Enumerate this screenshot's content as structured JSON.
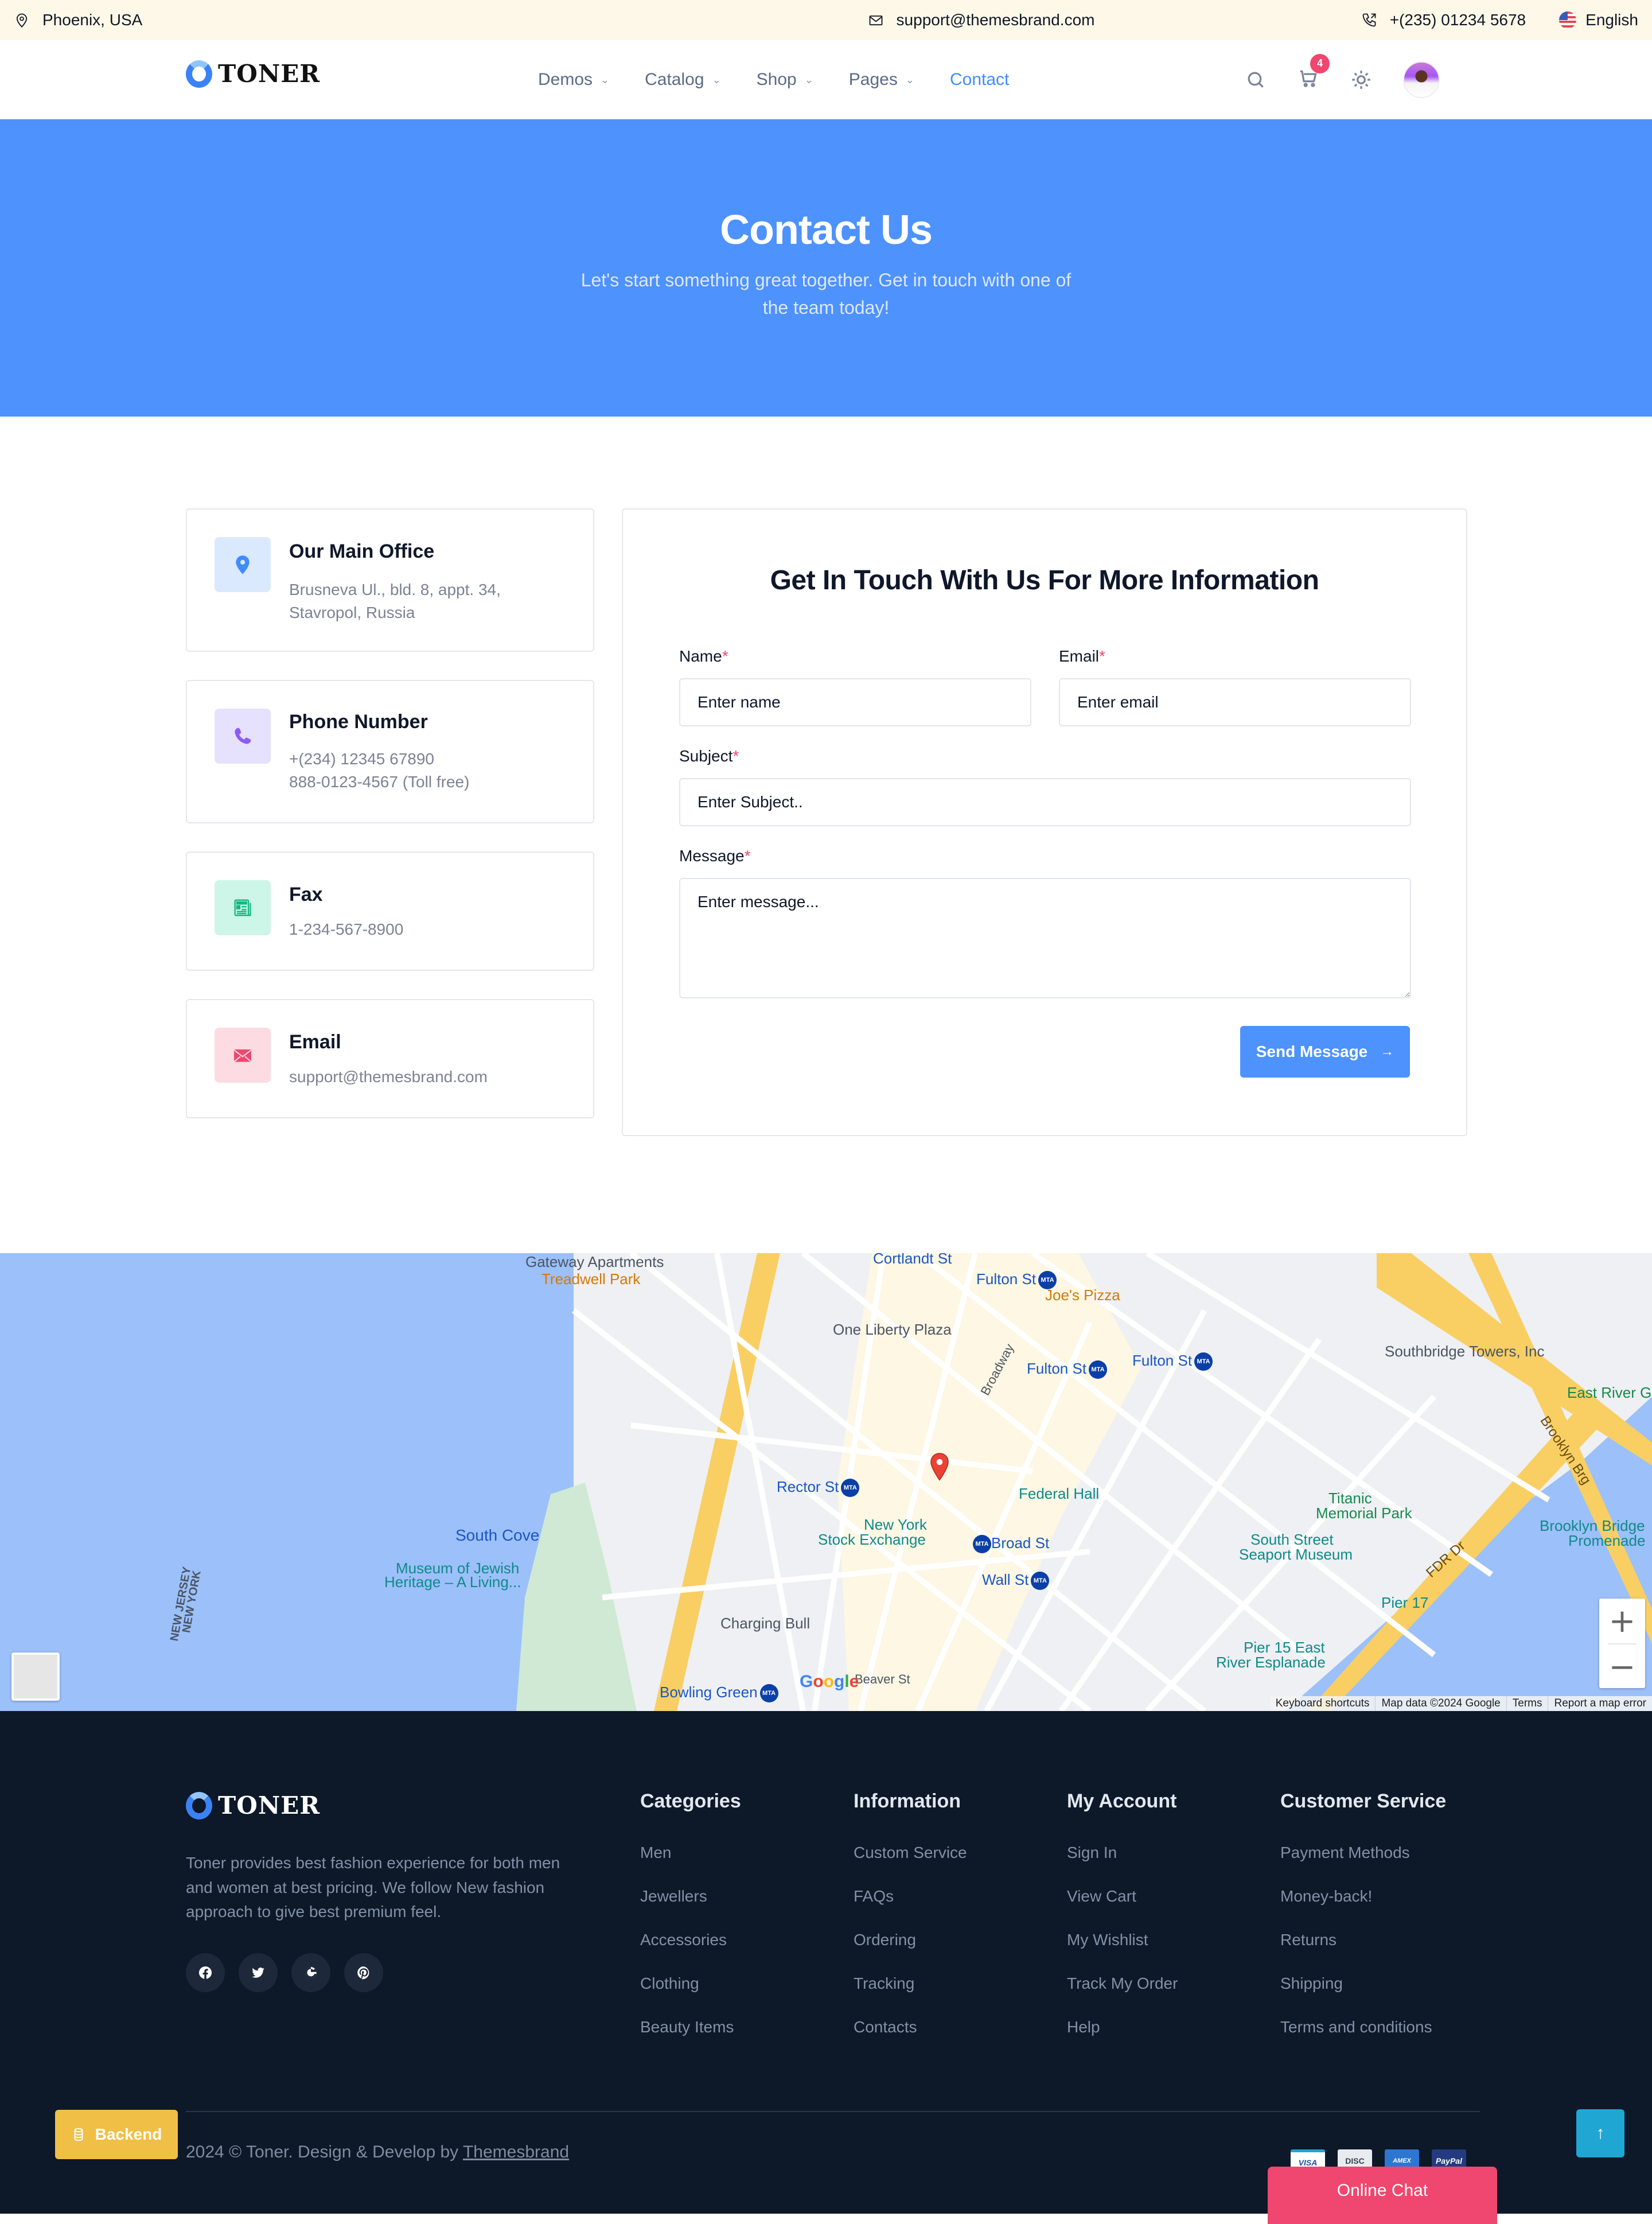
{
  "topbar": {
    "location": "Phoenix, USA",
    "email": "support@themesbrand.com",
    "phone": "+(235) 01234 5678",
    "language": "English"
  },
  "nav": {
    "brand": "TONER",
    "menu": [
      {
        "label": "Demos",
        "dropdown": true
      },
      {
        "label": "Catalog",
        "dropdown": true
      },
      {
        "label": "Shop",
        "dropdown": true
      },
      {
        "label": "Pages",
        "dropdown": true
      },
      {
        "label": "Contact",
        "dropdown": false,
        "active": true
      }
    ],
    "cart_count": "4",
    "icons": [
      "search-icon",
      "cart-icon",
      "theme-toggle-icon",
      "avatar"
    ]
  },
  "hero": {
    "title": "Contact Us",
    "subtitle": "Let's start something great together. Get in touch with one of the team today!"
  },
  "info_cards": [
    {
      "icon": "map-pin-icon",
      "title": "Our Main Office",
      "lines": [
        "Brusneva Ul., bld. 8, appt. 34,",
        "Stavropol, Russia"
      ],
      "color": "#3f8cff",
      "bg": "#dbe9ff"
    },
    {
      "icon": "phone-icon",
      "title": "Phone Number",
      "lines": [
        "+(234) 12345 67890",
        "888-0123-4567 (Toll free)"
      ],
      "color": "#8b5cf6",
      "bg": "#e6e1fd"
    },
    {
      "icon": "fax-icon",
      "title": "Fax",
      "lines": [
        "1-234-567-8900"
      ],
      "color": "#10b981",
      "bg": "#cdf6e8"
    },
    {
      "icon": "mail-icon",
      "title": "Email",
      "lines": [
        "support@themesbrand.com"
      ],
      "color": "#ef476f",
      "bg": "#fddbe3"
    }
  ],
  "form": {
    "title": "Get In Touch With Us For More Information",
    "name_label": "Name",
    "name_placeholder": "Enter name",
    "email_label": "Email",
    "email_placeholder": "Enter email",
    "subject_label": "Subject",
    "subject_placeholder": "Enter Subject..",
    "message_label": "Message",
    "message_placeholder": "Enter message...",
    "required_mark": "*",
    "submit_label": "Send Message",
    "submit_icon": "arrow-right-icon"
  },
  "map": {
    "labels": {
      "gateway": "Gateway Apartments",
      "treadwell": "Treadwell Park",
      "cortlandt": "Cortlandt St",
      "fulton1": "Fulton St",
      "joes": "Joe's Pizza",
      "liberty_plaza": "One Liberty Plaza",
      "fulton2": "Fulton St",
      "fulton3": "Fulton St",
      "southbridge": "Southbridge Towers, Inc",
      "east_river": "East River G",
      "rector": "Rector St",
      "federal_hall": "Federal Hall",
      "nyse1": "New York",
      "nyse2": "Stock Exchange",
      "broad": "Broad St",
      "wall": "Wall St",
      "south_cove": "South Cove",
      "museum1": "Museum of Jewish",
      "museum2": "Heritage – A Living...",
      "titanic1": "Titanic",
      "titanic2": "Memorial Park",
      "seaport1": "South Street",
      "seaport2": "Seaport Museum",
      "bb1": "Brooklyn Bridge",
      "bb2": "Promenade",
      "pier17": "Pier 17",
      "pier15a": "Pier 15 East",
      "pier15b": "River Esplanade",
      "charging_bull": "Charging Bull",
      "bowling_green": "Bowling Green",
      "nj": "NEW JERSEY",
      "ny": "NEW YORK",
      "broadway": "Broadway",
      "fdr": "FDR Dr",
      "brooklyn_brg": "Brooklyn Brg",
      "beaver": "Beaver St",
      "mta": "MTA"
    },
    "google": "Google",
    "zoom_in": "+",
    "zoom_out": "−",
    "attribution": [
      "Keyboard shortcuts",
      "Map data ©2024 Google",
      "Terms",
      "Report a map error"
    ]
  },
  "footer": {
    "brand": "TONER",
    "about": "Toner provides best fashion experience for both men and women at best pricing. We follow New fashion approach to give best premium feel.",
    "socials": [
      "facebook-icon",
      "twitter-icon",
      "google-icon",
      "pinterest-icon"
    ],
    "columns": [
      {
        "title": "Categories",
        "links": [
          "Men",
          "Jewellers",
          "Accessories",
          "Clothing",
          "Beauty Items"
        ]
      },
      {
        "title": "Information",
        "links": [
          "Custom Service",
          "FAQs",
          "Ordering",
          "Tracking",
          "Contacts"
        ]
      },
      {
        "title": "My Account",
        "links": [
          "Sign In",
          "View Cart",
          "My Wishlist",
          "Track My Order",
          "Help"
        ]
      },
      {
        "title": "Customer Service",
        "links": [
          "Payment Methods",
          "Money-back!",
          "Returns",
          "Shipping",
          "Terms and conditions"
        ]
      }
    ],
    "copyright_prefix": "2024 © Toner. Design & Develop by ",
    "copyright_link": "Themesbrand",
    "payments": [
      "VISA",
      "DISC",
      "AMEX",
      "PayPal"
    ]
  },
  "floating": {
    "backend_label": "Backend",
    "chat_label": "Online Chat",
    "to_top_icon": "arrow-up-icon"
  },
  "colors": {
    "primary": "#4d92fd",
    "danger": "#ef476f",
    "warning": "#f0bf46",
    "info": "#1fa6d3",
    "footer_bg": "#0d1829",
    "topbar_bg": "#fef8e8"
  }
}
